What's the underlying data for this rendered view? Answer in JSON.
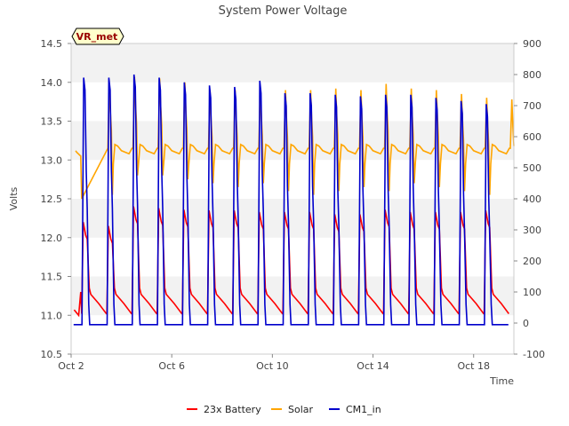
{
  "chart_data": {
    "type": "line",
    "title": "System Power Voltage",
    "xlabel": "Time",
    "ylabel": "Volts",
    "badge": "VR_met",
    "x_ticks": [
      {
        "day": 2,
        "label": "Oct 2"
      },
      {
        "day": 6,
        "label": "Oct 6"
      },
      {
        "day": 10,
        "label": "Oct 10"
      },
      {
        "day": 14,
        "label": "Oct 14"
      },
      {
        "day": 18,
        "label": "Oct 18"
      }
    ],
    "xlim_days": [
      2.0,
      19.6
    ],
    "ylim": [
      10.5,
      14.5
    ],
    "y_ticks": [
      "10.5",
      "11.0",
      "11.5",
      "12.0",
      "12.5",
      "13.0",
      "13.5",
      "14.0",
      "14.5"
    ],
    "y2lim": [
      -100,
      900
    ],
    "y2_ticks": [
      "-100",
      "0",
      "100",
      "200",
      "300",
      "400",
      "500",
      "600",
      "700",
      "800",
      "900"
    ],
    "grid": false,
    "banded_background": true,
    "legend_position": "bottom",
    "legend": [
      {
        "label": "23x Battery",
        "color": "#ff0000"
      },
      {
        "label": "Solar",
        "color": "#ffa500"
      },
      {
        "label": "CM1_in",
        "color": "#0000cc"
      }
    ],
    "day_numbers": [
      2,
      3,
      4,
      5,
      6,
      7,
      8,
      9,
      10,
      11,
      12,
      13,
      14,
      15,
      16,
      17,
      18,
      19
    ],
    "series": [
      {
        "name": "23x Battery",
        "axis": "left",
        "color": "#ff0000",
        "night_start_volts": 11.27,
        "night_end_volts": 11.02,
        "daily_peak_volts": [
          null,
          12.2,
          12.15,
          12.4,
          12.38,
          12.36,
          12.35,
          12.35,
          12.33,
          12.33,
          12.33,
          12.3,
          12.3,
          12.36,
          12.33,
          12.33,
          12.33,
          12.35,
          12.33
        ]
      },
      {
        "name": "Solar",
        "axis": "left",
        "color": "#ffa500",
        "night_volts": 13.15,
        "daily_peak_volts": [
          null,
          13.98,
          14.07,
          14.05,
          14.0,
          13.9,
          13.9,
          13.92,
          13.9,
          13.9,
          13.92,
          13.9,
          13.98,
          13.92,
          13.9,
          13.85,
          13.8,
          13.78
        ],
        "daily_dip_volts": [
          null,
          12.55,
          12.8,
          12.8,
          12.75,
          12.7,
          12.65,
          12.7,
          12.6,
          12.55,
          12.6,
          12.65,
          12.6,
          12.7,
          12.65,
          12.6,
          12.55,
          12.65
        ]
      },
      {
        "name": "CM1_in",
        "axis": "right",
        "color": "#0000cc",
        "night_value": -5,
        "daily_peak_values": [
          null,
          790,
          790,
          800,
          790,
          775,
          765,
          760,
          780,
          740,
          740,
          735,
          730,
          735,
          735,
          725,
          715,
          705
        ]
      }
    ]
  }
}
